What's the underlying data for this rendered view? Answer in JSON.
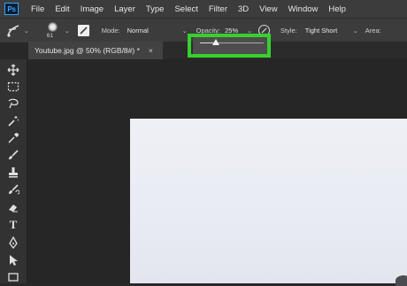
{
  "app": {
    "logo_text": "Ps"
  },
  "menu": [
    "File",
    "Edit",
    "Image",
    "Layer",
    "Type",
    "Select",
    "Filter",
    "3D",
    "View",
    "Window",
    "Help"
  ],
  "options": {
    "brush_size": "61",
    "mode_label": "Mode:",
    "mode_value": "Normal",
    "opacity_label": "Opacity:",
    "opacity_value": "25%",
    "opacity_fraction": 0.25,
    "style_label": "Style:",
    "style_value": "Tight Short",
    "area_label": "Area:"
  },
  "tab": {
    "title": "Youtube.jpg @ 50% (RGB/8#) *",
    "close": "×"
  },
  "tools": [
    "move-tool",
    "marquee-tool",
    "lasso-tool",
    "magic-wand-tool",
    "eyedropper-tool",
    "brush-tool",
    "stamp-tool",
    "history-brush-tool",
    "eraser-tool",
    "type-tool",
    "pen-tool",
    "path-selection-tool",
    "shape-tool"
  ],
  "type_tool_glyph": "T",
  "colors": {
    "highlight": "#36d12e",
    "accent": "#31a8ff",
    "canvas": "#eceef4"
  }
}
